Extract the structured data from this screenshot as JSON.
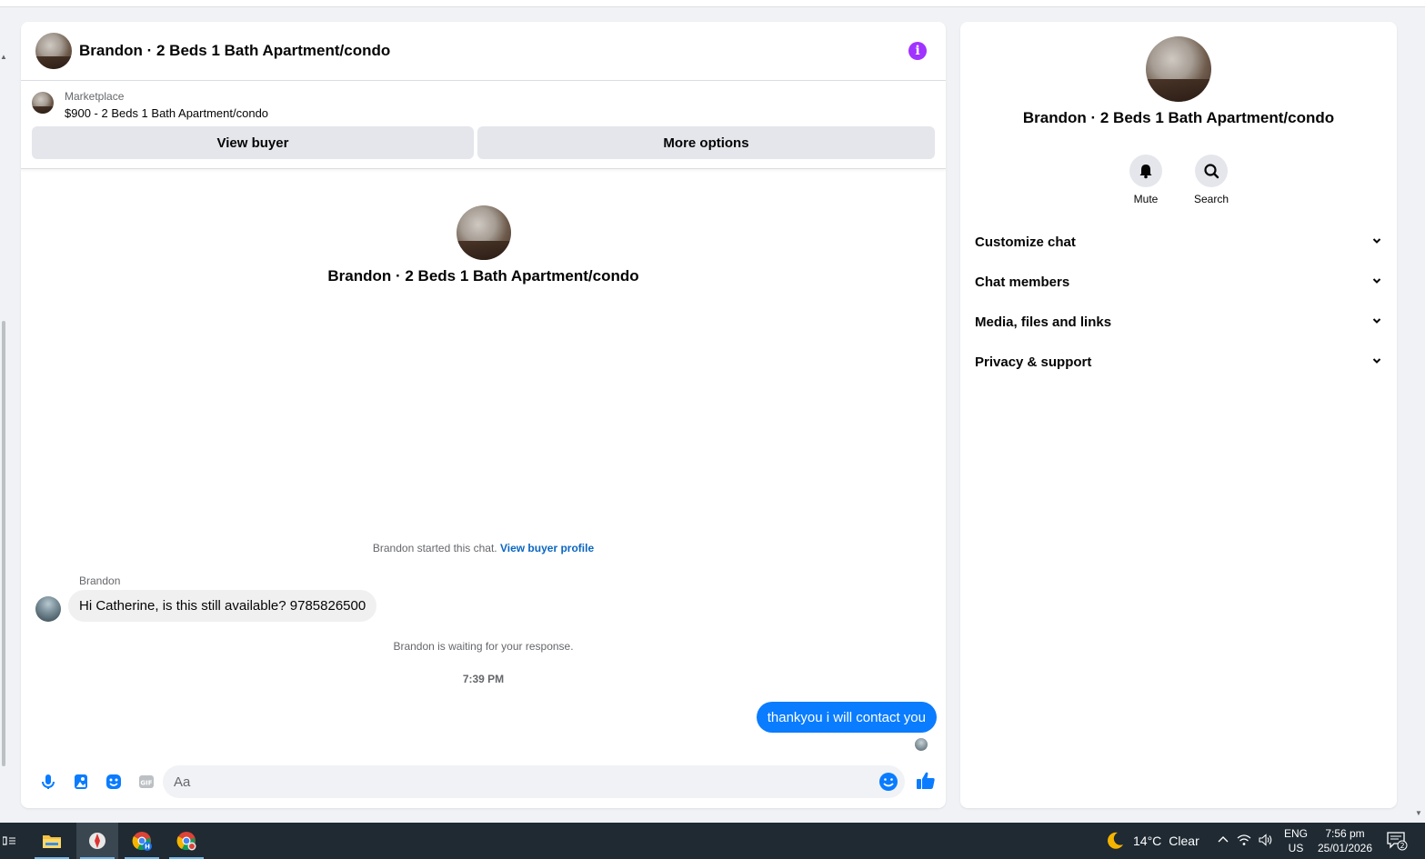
{
  "chat": {
    "title": "Brandon · 2 Beds 1 Bath Apartment/condo",
    "marketplace_label": "Marketplace",
    "marketplace_item": "$900 - 2 Beds 1 Bath Apartment/condo",
    "view_buyer_label": "View buyer",
    "more_options_label": "More options",
    "profile_name": "Brandon · 2 Beds 1 Bath Apartment/condo",
    "started_text": "Brandon started this chat.",
    "view_buyer_profile_link": "View buyer profile",
    "sender_name": "Brandon",
    "incoming_message": "Hi Catherine, is this still available? 9785826500",
    "waiting_text": "Brandon is waiting for your response.",
    "timestamp": "7:39 PM",
    "outgoing_message": "thankyou i will contact you",
    "input_placeholder": "Aa"
  },
  "side": {
    "name": "Brandon · 2 Beds 1 Bath Apartment/condo",
    "actions": [
      {
        "label": "Mute",
        "icon": "bell-icon"
      },
      {
        "label": "Search",
        "icon": "search-icon"
      }
    ],
    "menu": [
      {
        "label": "Customize chat"
      },
      {
        "label": "Chat members"
      },
      {
        "label": "Media, files and links"
      },
      {
        "label": "Privacy & support"
      }
    ]
  },
  "taskbar": {
    "weather_temp": "14°C",
    "weather_desc": "Clear",
    "lang_1": "ENG",
    "lang_2": "US",
    "time": "7:56 pm",
    "date": "25/01/2026",
    "notification_count": "2"
  },
  "colors": {
    "accent_blue": "#0a7cff",
    "info_purple": "#a033ff",
    "link_blue": "#0a66c2",
    "taskbar_bg": "#1f2a33"
  }
}
